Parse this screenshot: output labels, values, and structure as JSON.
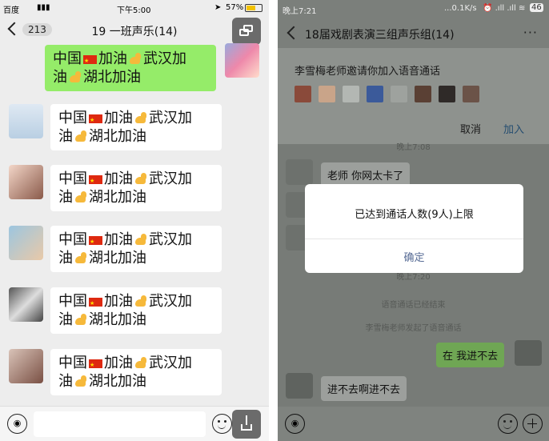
{
  "left": {
    "status": {
      "carrier": "百度",
      "time": "下午5:00",
      "battery": "57%"
    },
    "header": {
      "unread": "213",
      "title": "19 一班声乐(14)"
    },
    "message": {
      "part1": "中国",
      "part2": "加油",
      "part3": "武汉加",
      "part4": "油",
      "part5": "湖北加油"
    },
    "message_count": 6
  },
  "right": {
    "status": {
      "time": "晚上7:21",
      "speed": "...0.1K/s",
      "battery": "46"
    },
    "header": {
      "title": "18届戏剧表演三组声乐组(14)",
      "more": "···"
    },
    "invite": {
      "text": "李雪梅老师邀请你加入语音通话",
      "cancel": "取消",
      "join": "加入"
    },
    "time1": "晚上7:08",
    "msg1": "老师 你网太卡了",
    "time2": "晚上7:20",
    "sys1": "语音通话已经结束",
    "sys2": "李雪梅老师发起了语音通话",
    "my_msg": "在 我进不去",
    "msg_last": "进不去啊进不去",
    "dialog": {
      "message": "已达到通话人数(9人)上限",
      "ok": "确定"
    }
  },
  "colors": {
    "bubble_green": "#95ec69",
    "link_blue": "#576b95",
    "chat_bg": "#ededed"
  }
}
